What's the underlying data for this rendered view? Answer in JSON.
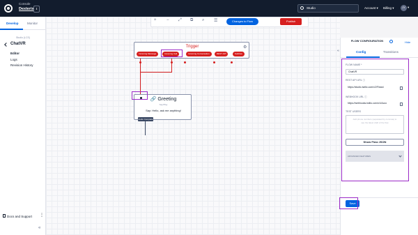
{
  "topbar": {
    "console_label": "Console",
    "account_name": "Dexterix",
    "account_switcher": "⇕",
    "search_value": "Studio",
    "menu": [
      "Account",
      "Billing"
    ],
    "avatar_initials": "JY"
  },
  "sidebar": {
    "tabs": [
      "Develop",
      "Monitor"
    ],
    "studio_label": "Studio (LCS)",
    "flow_name": "ChatVR",
    "items": [
      "Editor",
      "Logs",
      "Revision History"
    ],
    "docs_label": "Docs and Support",
    "more": "⋮",
    "collapse": "«"
  },
  "toolbar": {
    "tools": [
      "+",
      "−",
      "⤢",
      "⧉",
      "⌕",
      "☰"
    ],
    "changes_label": "Changes to Flow",
    "publish_label": "Publish"
  },
  "trigger": {
    "title": "Trigger",
    "pills": [
      "Incoming Message",
      "Incoming Call",
      "Incoming Conversation",
      "REST API",
      "Subflow"
    ]
  },
  "greeting": {
    "title": "Greeting",
    "type": "Say/Play",
    "body": "Say: Hello, ask me anything!",
    "audio_label": "Audio Complete"
  },
  "panel": {
    "title": "FLOW CONFIGURATION",
    "hide_label": "Hide",
    "tabs": [
      "Config",
      "Transitions"
    ],
    "flow_name_label": "FLOW NAME *",
    "flow_name_value": "ChatVR",
    "rest_api_label": "REST API URL",
    "rest_api_value": "https://studio.twilio.com/v2/Flows/",
    "webhook_label": "WEBHOOK URL",
    "webhook_value": "https://webhooks.twilio.com/v1/Acco",
    "test_users_label": "TEST USERS",
    "test_users_placeholder": "Add phone numbers (separated by commas) to see the latest draft of the flow",
    "json_button": "Show Flow JSON",
    "advanced_label": "ADVANCED FEATURES",
    "save_label": "Save"
  },
  "colors": {
    "accent": "#0263e0",
    "danger": "#d61f1f",
    "highlight": "#9b2ac7",
    "topbar": "#121c2d"
  }
}
